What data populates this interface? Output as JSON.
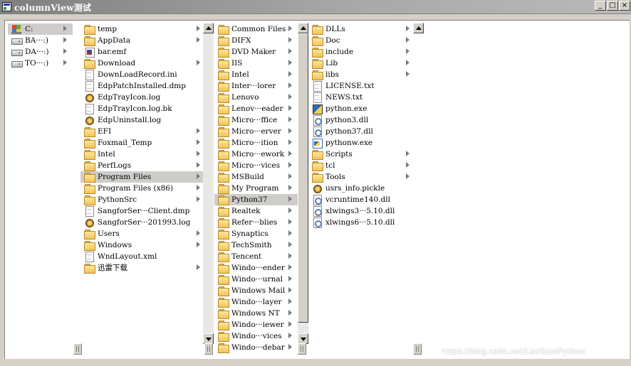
{
  "window": {
    "title": "columnView测试",
    "minimize_glyph": "_",
    "maximize_glyph": "□",
    "close_glyph": "×"
  },
  "columns": [
    {
      "name": "drives",
      "items": [
        {
          "label": "C:",
          "icon": "drive-c-icon",
          "kind": "winlogo",
          "arrow": true,
          "selected": true
        },
        {
          "label": "BA···:)",
          "icon": "drive-icon",
          "kind": "drive",
          "arrow": true
        },
        {
          "label": "DA···:)",
          "icon": "drive-icon",
          "kind": "drive",
          "arrow": true
        },
        {
          "label": "TO···:)",
          "icon": "drive-icon",
          "kind": "drive",
          "arrow": true
        }
      ]
    },
    {
      "name": "c-root",
      "items": [
        {
          "label": "temp",
          "icon": "folder-icon",
          "kind": "folder",
          "arrow": true
        },
        {
          "label": "AppData",
          "icon": "folder-icon",
          "kind": "folder",
          "arrow": true
        },
        {
          "label": "bar.emf",
          "icon": "emf-file-icon",
          "kind": "emf",
          "arrow": false
        },
        {
          "label": "Download",
          "icon": "folder-icon",
          "kind": "folder",
          "arrow": true
        },
        {
          "label": "DownLoadRecord.ini",
          "icon": "file-icon",
          "kind": "file",
          "arrow": false
        },
        {
          "label": "EdpPatchInstalled.dmp",
          "icon": "file-icon",
          "kind": "file",
          "arrow": false
        },
        {
          "label": "EdpTrayIcon.log",
          "icon": "log-file-icon",
          "kind": "cfg",
          "arrow": false
        },
        {
          "label": "EdpTrayIcon.log.bk",
          "icon": "file-icon",
          "kind": "file",
          "arrow": false
        },
        {
          "label": "EdpUninstall.log",
          "icon": "log-file-icon",
          "kind": "cfg",
          "arrow": false
        },
        {
          "label": "EFI",
          "icon": "folder-icon",
          "kind": "folder",
          "arrow": true
        },
        {
          "label": "Foxmail_Temp",
          "icon": "folder-icon",
          "kind": "folder",
          "arrow": true
        },
        {
          "label": "Intel",
          "icon": "folder-icon",
          "kind": "folder",
          "arrow": true
        },
        {
          "label": "PerfLogs",
          "icon": "folder-icon",
          "kind": "folder",
          "arrow": true
        },
        {
          "label": "Program Files",
          "icon": "folder-icon",
          "kind": "folder",
          "arrow": true,
          "selected": true
        },
        {
          "label": "Program Files (x86)",
          "icon": "folder-icon",
          "kind": "folder",
          "arrow": true
        },
        {
          "label": "PythonSrc",
          "icon": "folder-icon",
          "kind": "folder",
          "arrow": true
        },
        {
          "label": "SangforSer···Client.dmp",
          "icon": "file-icon",
          "kind": "file",
          "arrow": false
        },
        {
          "label": "SangforSer···201993.log",
          "icon": "log-file-icon",
          "kind": "cfg",
          "arrow": false
        },
        {
          "label": "Users",
          "icon": "folder-icon",
          "kind": "folder",
          "arrow": true
        },
        {
          "label": "Windows",
          "icon": "folder-icon",
          "kind": "folder",
          "arrow": true
        },
        {
          "label": "WndLayout.xml",
          "icon": "file-icon",
          "kind": "file",
          "arrow": false
        },
        {
          "label": "迅雷下载",
          "icon": "folder-icon",
          "kind": "folder",
          "arrow": true
        }
      ]
    },
    {
      "name": "program-files",
      "items": [
        {
          "label": "Common Files",
          "icon": "folder-icon",
          "kind": "folder",
          "arrow": true
        },
        {
          "label": "DIFX",
          "icon": "folder-icon",
          "kind": "folder",
          "arrow": true
        },
        {
          "label": "DVD Maker",
          "icon": "folder-icon",
          "kind": "folder",
          "arrow": true
        },
        {
          "label": "IIS",
          "icon": "folder-icon",
          "kind": "folder",
          "arrow": true
        },
        {
          "label": "Intel",
          "icon": "folder-icon",
          "kind": "folder",
          "arrow": true
        },
        {
          "label": "Inter···lorer",
          "icon": "folder-icon",
          "kind": "folder",
          "arrow": true
        },
        {
          "label": "Lenovo",
          "icon": "folder-icon",
          "kind": "folder",
          "arrow": true
        },
        {
          "label": "Lenov···eader",
          "icon": "folder-icon",
          "kind": "folder",
          "arrow": true
        },
        {
          "label": "Micro···ffice",
          "icon": "folder-icon",
          "kind": "folder",
          "arrow": true
        },
        {
          "label": "Micro···erver",
          "icon": "folder-icon",
          "kind": "folder",
          "arrow": true
        },
        {
          "label": "Micro···ition",
          "icon": "folder-icon",
          "kind": "folder",
          "arrow": true
        },
        {
          "label": "Micro···ework",
          "icon": "folder-icon",
          "kind": "folder",
          "arrow": true
        },
        {
          "label": "Micro···vices",
          "icon": "folder-icon",
          "kind": "folder",
          "arrow": true
        },
        {
          "label": "MSBuild",
          "icon": "folder-icon",
          "kind": "folder",
          "arrow": true
        },
        {
          "label": "My Program",
          "icon": "folder-icon",
          "kind": "folder",
          "arrow": true
        },
        {
          "label": "Python37",
          "icon": "folder-icon",
          "kind": "folder",
          "arrow": true,
          "selected": true
        },
        {
          "label": "Realtek",
          "icon": "folder-icon",
          "kind": "folder",
          "arrow": true
        },
        {
          "label": "Refer···blies",
          "icon": "folder-icon",
          "kind": "folder",
          "arrow": true
        },
        {
          "label": "Synaptics",
          "icon": "folder-icon",
          "kind": "folder",
          "arrow": true
        },
        {
          "label": "TechSmith",
          "icon": "folder-icon",
          "kind": "folder",
          "arrow": true
        },
        {
          "label": "Tencent",
          "icon": "folder-icon",
          "kind": "folder",
          "arrow": true
        },
        {
          "label": "Windo···ender",
          "icon": "folder-icon",
          "kind": "folder",
          "arrow": true
        },
        {
          "label": "Windo···urnal",
          "icon": "folder-icon",
          "kind": "folder",
          "arrow": true
        },
        {
          "label": "Windows Mail",
          "icon": "folder-icon",
          "kind": "folder",
          "arrow": true
        },
        {
          "label": "Windo···layer",
          "icon": "folder-icon",
          "kind": "folder",
          "arrow": true
        },
        {
          "label": "Windows NT",
          "icon": "folder-icon",
          "kind": "folder",
          "arrow": true
        },
        {
          "label": "Windo···iewer",
          "icon": "folder-icon",
          "kind": "folder",
          "arrow": true
        },
        {
          "label": "Windo···vices",
          "icon": "folder-icon",
          "kind": "folder",
          "arrow": true
        },
        {
          "label": "Windo···debar",
          "icon": "folder-icon",
          "kind": "folder",
          "arrow": true
        }
      ]
    },
    {
      "name": "python37",
      "items": [
        {
          "label": "DLLs",
          "icon": "folder-icon",
          "kind": "folder",
          "arrow": true
        },
        {
          "label": "Doc",
          "icon": "folder-icon",
          "kind": "folder",
          "arrow": true
        },
        {
          "label": "include",
          "icon": "folder-icon",
          "kind": "folder",
          "arrow": true
        },
        {
          "label": "Lib",
          "icon": "folder-icon",
          "kind": "folder",
          "arrow": true
        },
        {
          "label": "libs",
          "icon": "folder-icon",
          "kind": "folder",
          "arrow": true
        },
        {
          "label": "LICENSE.txt",
          "icon": "file-icon",
          "kind": "file",
          "arrow": false
        },
        {
          "label": "NEWS.txt",
          "icon": "file-icon",
          "kind": "file",
          "arrow": false
        },
        {
          "label": "python.exe",
          "icon": "python-exe-icon",
          "kind": "exe",
          "arrow": false
        },
        {
          "label": "python3.dll",
          "icon": "dll-file-icon",
          "kind": "dll",
          "arrow": false
        },
        {
          "label": "python37.dll",
          "icon": "dll-file-icon",
          "kind": "dll",
          "arrow": false
        },
        {
          "label": "pythonw.exe",
          "icon": "pythonw-exe-icon",
          "kind": "exew",
          "arrow": false
        },
        {
          "label": "Scripts",
          "icon": "folder-icon",
          "kind": "folder",
          "arrow": true
        },
        {
          "label": "tcl",
          "icon": "folder-icon",
          "kind": "folder",
          "arrow": true
        },
        {
          "label": "Tools",
          "icon": "folder-icon",
          "kind": "folder",
          "arrow": true
        },
        {
          "label": "usrs_info.pickle",
          "icon": "pickle-file-icon",
          "kind": "cfg",
          "arrow": false
        },
        {
          "label": "vcruntime140.dll",
          "icon": "dll-file-icon",
          "kind": "dll",
          "arrow": false
        },
        {
          "label": "xlwings3···5.10.dll",
          "icon": "dll-file-icon",
          "kind": "dll",
          "arrow": false
        },
        {
          "label": "xlwings6···5.10.dll",
          "icon": "dll-file-icon",
          "kind": "dll",
          "arrow": false
        }
      ]
    }
  ],
  "watermark": "https://blog.csdn.net/LaoYuanPython"
}
